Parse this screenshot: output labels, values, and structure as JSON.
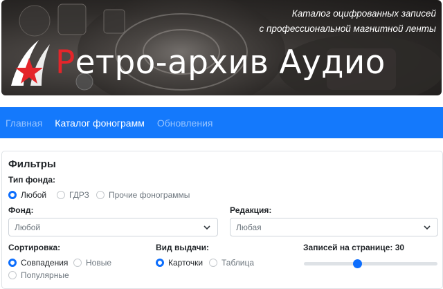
{
  "banner": {
    "title_first": "Р",
    "title_rest": "етро-архив Аудио",
    "tagline_line1": "Каталог оцифрованных записей",
    "tagline_line2": "с профессиональной магнитной ленты"
  },
  "nav": {
    "items": [
      {
        "label": "Главная",
        "active": false
      },
      {
        "label": "Каталог фонограмм",
        "active": true
      },
      {
        "label": "Обновления",
        "active": false
      }
    ]
  },
  "filters": {
    "title": "Фильтры",
    "fund_type": {
      "label": "Тип фонда:",
      "options": [
        "Любой",
        "ГДРЗ",
        "Прочие фонограммы"
      ],
      "selected": "Любой"
    },
    "fund": {
      "label": "Фонд:",
      "value": "Любой"
    },
    "edition": {
      "label": "Редакция:",
      "value": "Любая"
    },
    "sort": {
      "label": "Сортировка:",
      "options": [
        "Совпадения",
        "Новые",
        "Популярные"
      ],
      "selected": "Совпадения"
    },
    "view": {
      "label": "Вид выдачи:",
      "options": [
        "Карточки",
        "Таблица"
      ],
      "selected": "Карточки"
    },
    "per_page": {
      "label": "Записей на странице: 30",
      "value": 30,
      "fraction": 0.4
    }
  },
  "colors": {
    "navbar": "#1479fc",
    "accent": "#0d6efd",
    "logo_red": "#e4252a"
  }
}
